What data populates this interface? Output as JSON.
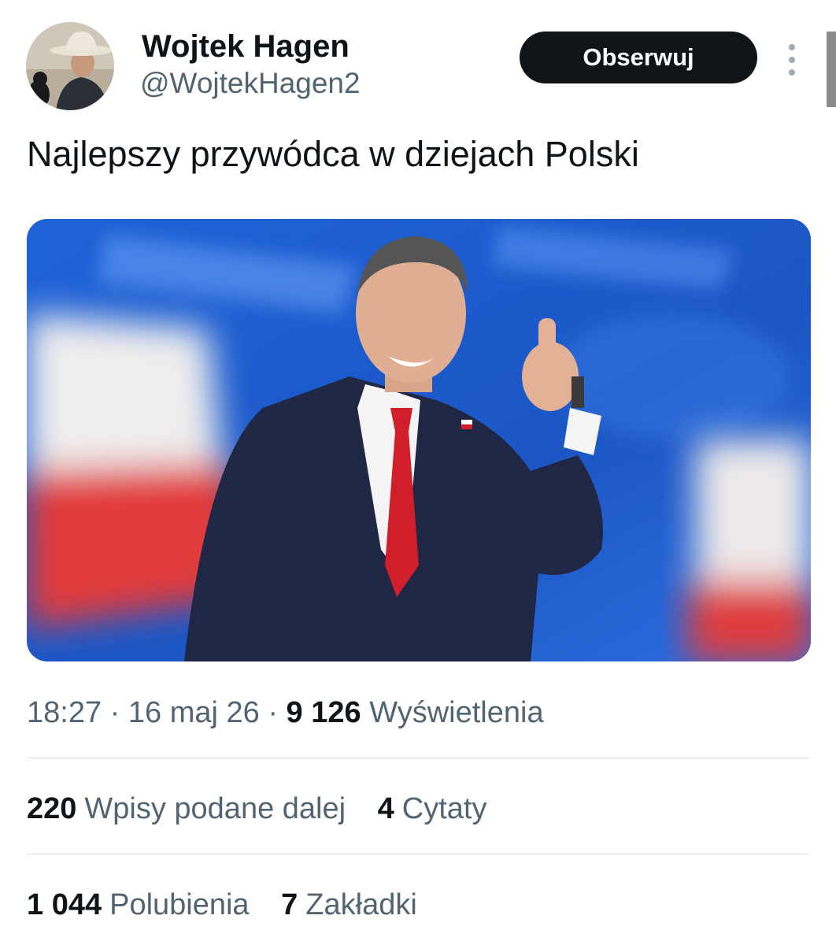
{
  "author": {
    "name": "Wojtek Hagen",
    "handle": "@WojtekHagen2"
  },
  "follow_button": {
    "label": "Obserwuj"
  },
  "tweet": {
    "text": "Najlepszy przywódca w dziejach Polski"
  },
  "meta": {
    "time": "18:27",
    "date": "16 maj 26",
    "views_count": "9 126",
    "views_label": "Wyświetlenia"
  },
  "stats_row1": [
    {
      "count": "220",
      "label": "Wpisy podane dalej"
    },
    {
      "count": "4",
      "label": "Cytaty"
    }
  ],
  "stats_row2": [
    {
      "count": "1 044",
      "label": "Polubienia"
    },
    {
      "count": "7",
      "label": "Zakładki"
    }
  ],
  "colors": {
    "text_primary": "#0f1419",
    "text_secondary": "#536471",
    "button_bg": "#0f1419",
    "divider": "#dcdfe2"
  },
  "icons": [
    "more-vertical-icon"
  ]
}
